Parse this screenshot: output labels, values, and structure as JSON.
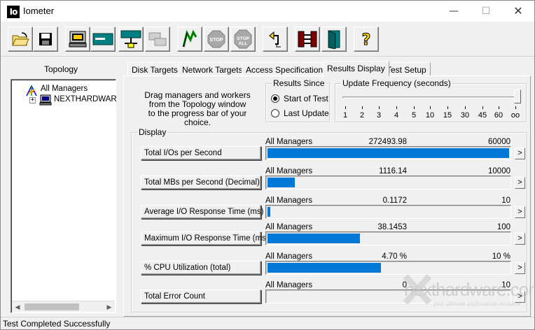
{
  "window": {
    "icon_text": "Io",
    "title": "Iometer",
    "minimize_glyph": "—",
    "maximize_glyph": "☐",
    "close_glyph": "✕"
  },
  "toolbar": {
    "buttons": [
      {
        "icon": "open-folder-icon"
      },
      {
        "icon": "save-disk-icon"
      },
      {
        "icon": "start-display-manager-icon"
      },
      {
        "icon": "new-worker-icon"
      },
      {
        "icon": "new-network-worker-icon"
      },
      {
        "icon": "duplicate-worker-icon"
      },
      {
        "icon": "start-flag-icon"
      },
      {
        "icon": "stop-icon",
        "label": "STOP"
      },
      {
        "icon": "stop-all-icon",
        "label": "STOP ALL"
      },
      {
        "icon": "reset-workers-icon"
      },
      {
        "icon": "exit-icon"
      },
      {
        "icon": "disconnect-icon"
      },
      {
        "icon": "help-icon",
        "label": "?"
      }
    ]
  },
  "topology": {
    "header": "Topology",
    "root": "All Managers",
    "manager": "NEXTHARDWAR"
  },
  "tabs": [
    {
      "label": "Disk Targets",
      "active": false
    },
    {
      "label": "Network Targets",
      "active": false
    },
    {
      "label": "Access Specifications",
      "active": false
    },
    {
      "label": "Results Display",
      "active": true
    },
    {
      "label": "Test Setup",
      "active": false
    }
  ],
  "description": [
    "Drag managers and workers",
    "from the Topology window",
    "to the progress bar of your choice."
  ],
  "results_since": {
    "title": "Results Since",
    "options": [
      {
        "label": "Start of Test",
        "checked": true
      },
      {
        "label": "Last Update",
        "checked": false
      }
    ]
  },
  "update_frequency": {
    "title": "Update Frequency (seconds)",
    "ticks": [
      "1",
      "2",
      "3",
      "4",
      "5",
      "10",
      "15",
      "30",
      "45",
      "60",
      "oo"
    ],
    "selected": "oo"
  },
  "display": {
    "title": "Display",
    "metrics": [
      {
        "button": "Total I/Os per Second",
        "source": "All Managers",
        "value": "272493.98",
        "max": "60000",
        "fill": 1.0
      },
      {
        "button": "Total MBs per Second (Decimal)",
        "source": "All Managers",
        "value": "1116.14",
        "max": "10000",
        "fill": 0.1116
      },
      {
        "button": "Average I/O Response Time (ms)",
        "source": "All Managers",
        "value": "0.1172",
        "max": "10",
        "fill": 0.0117
      },
      {
        "button": "Maximum I/O Response Time (ms)",
        "source": "All Managers",
        "value": "38.1453",
        "max": "100",
        "fill": 0.3815
      },
      {
        "button": "% CPU Utilization (total)",
        "source": "All Managers",
        "value": "4.70 %",
        "max": "10 %",
        "fill": 0.47
      },
      {
        "button": "Total Error Count",
        "source": "All Managers",
        "value": "0",
        "max": "10",
        "fill": 0
      }
    ],
    "arrow_glyph": ">"
  },
  "status": "Test Completed Successfully",
  "watermark": {
    "text": "nexthardware.com",
    "sub": "your ultimate professional resource"
  }
}
